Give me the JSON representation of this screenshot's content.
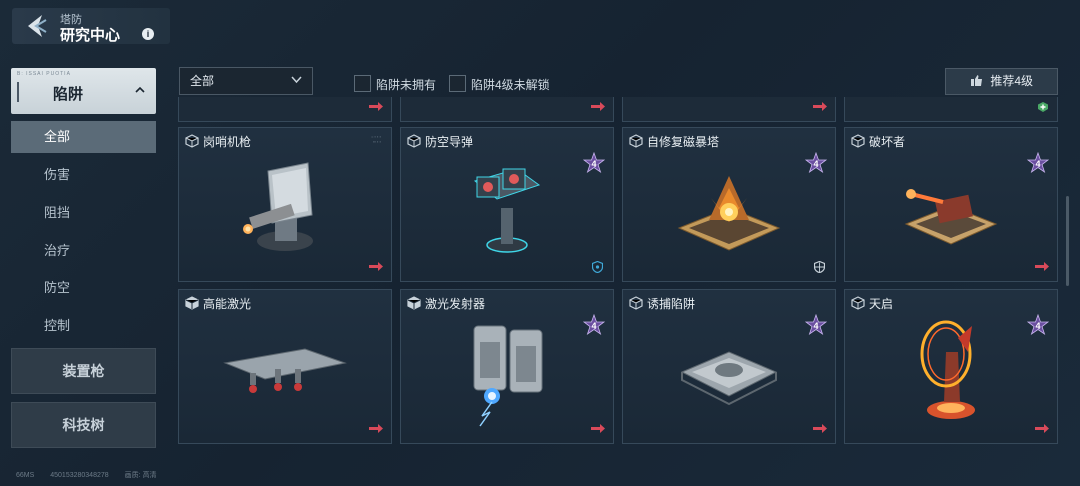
{
  "header": {
    "category": "塔防",
    "title": "研究中心",
    "info": "i"
  },
  "sidebar": {
    "section": {
      "label": "陷阱",
      "tiny": "B: ISSAI PUOTIA"
    },
    "items": [
      {
        "label": "全部",
        "active": true
      },
      {
        "label": "伤害"
      },
      {
        "label": "阻挡"
      },
      {
        "label": "治疗"
      },
      {
        "label": "防空"
      },
      {
        "label": "控制"
      }
    ],
    "buttons": [
      {
        "label": "装置枪"
      },
      {
        "label": "科技树"
      }
    ]
  },
  "filters": {
    "dropdown": {
      "value": "全部"
    },
    "checkboxes": [
      {
        "label": "陷阱未拥有"
      },
      {
        "label": "陷阱4级未解锁"
      }
    ],
    "recommend": {
      "label": "推荐4级"
    }
  },
  "cards": [
    {
      "name": "岗哨机枪",
      "level_badge": false,
      "corner": "arrow"
    },
    {
      "name": "防空导弹",
      "level_badge": "4",
      "corner": "shield"
    },
    {
      "name": "自修复磁暴塔",
      "level_badge": "4",
      "corner": "shield"
    },
    {
      "name": "破坏者",
      "level_badge": "4",
      "corner": "arrow"
    },
    {
      "name": "高能激光",
      "level_badge": false,
      "corner": "arrow"
    },
    {
      "name": "激光发射器",
      "level_badge": "4",
      "corner": "arrow"
    },
    {
      "name": "诱捕陷阱",
      "level_badge": "4",
      "corner": "arrow"
    },
    {
      "name": "天启",
      "level_badge": "4",
      "corner": "arrow"
    }
  ],
  "footer": {
    "latency": "66MS",
    "id": "450153280348278",
    "quality_label": "画质:",
    "quality_value": "高清"
  },
  "colors": {
    "arrow": "#d94a5a",
    "badge": "#6b4fa0",
    "accent": "#5b6b78"
  }
}
